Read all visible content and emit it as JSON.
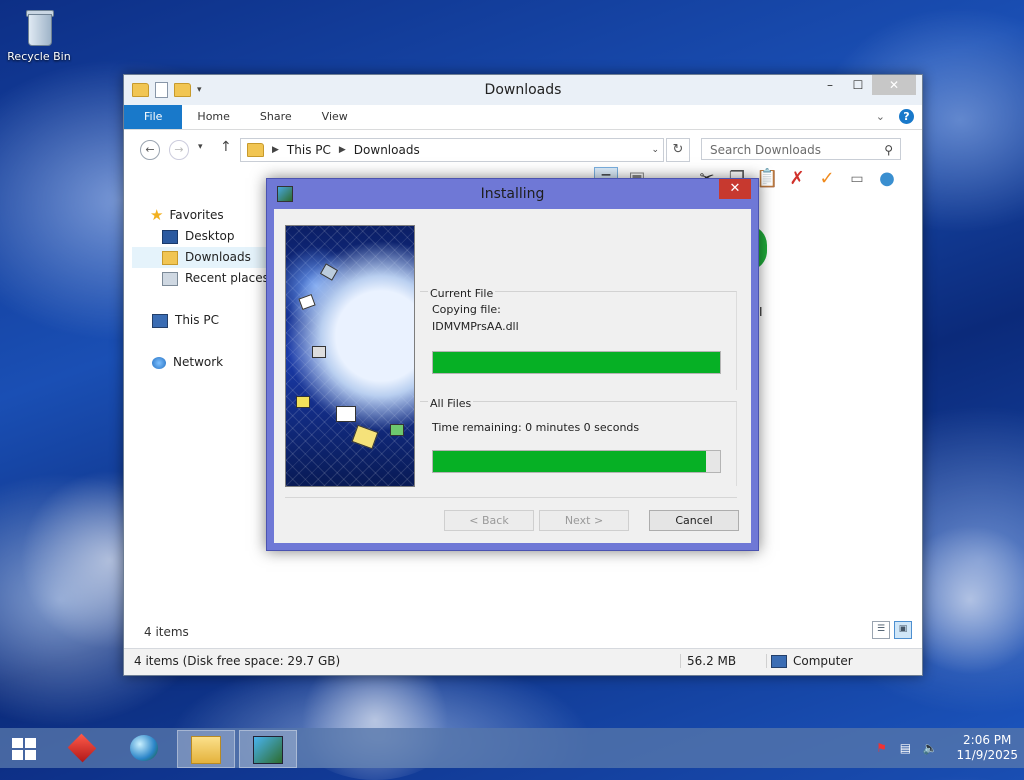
{
  "desktop": {
    "recycle_bin_label": "Recycle Bin"
  },
  "explorer": {
    "title": "Downloads",
    "window_buttons": [
      "–",
      "☐",
      "✕"
    ],
    "ribbon_tabs": [
      "File",
      "Home",
      "Share",
      "View"
    ],
    "address": {
      "crumbs": [
        "This PC",
        "Downloads"
      ]
    },
    "search_placeholder": "Search Downloads",
    "nav": {
      "favorites": "Favorites",
      "desktop": "Desktop",
      "downloads": "Downloads",
      "recent": "Recent places",
      "this_pc": "This PC",
      "network": "Network"
    },
    "partial_file_label": "NI",
    "items_count": "4 items",
    "status": {
      "summary": "4 items (Disk free space: 29.7 GB)",
      "size": "56.2 MB",
      "location": "Computer"
    }
  },
  "installer": {
    "title": "Installing",
    "close_glyph": "✕",
    "current_file_group": "Current File",
    "copying_label": "Copying file:",
    "file_name": "IDMVMPrsAA.dll",
    "current_progress": 1.0,
    "all_files_group": "All Files",
    "time_remaining": "Time remaining: 0 minutes 0 seconds",
    "all_progress": 0.95,
    "buttons": {
      "back": "< Back",
      "next": "Next >",
      "cancel": "Cancel"
    }
  },
  "taskbar": {
    "clock_time": "2:06 PM",
    "clock_date": "11/9/2025",
    "apps": [
      "start-icon",
      "red-app-icon",
      "globe-app-icon",
      "file-explorer-icon",
      "installer-icon"
    ]
  },
  "colors": {
    "progress_green": "#06b025",
    "ribbon_blue": "#1979ca",
    "dialog_frame": "#6f78d6",
    "close_red": "#c7392f"
  }
}
